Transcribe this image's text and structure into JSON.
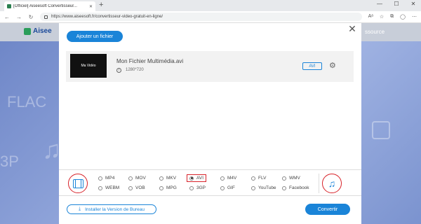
{
  "browser": {
    "tab_title": "[Officiel] Aiseesoft Convertisseur...",
    "tab_close": "✕",
    "new_tab": "+",
    "url": "https://www.aiseesoft.fr/convertisseur-video-gratuit-en-ligne/",
    "nav_back": "←",
    "nav_forward": "→",
    "nav_reload": "↻",
    "win_min": "—",
    "win_max": "☐",
    "win_close": "✕"
  },
  "page": {
    "logo_text": "Aisee",
    "ressource": "ssource",
    "deco_flac": "FLAC",
    "deco_3p": "3P",
    "deco_note": "♫"
  },
  "modal": {
    "close": "✕",
    "add_file_label": "Ajouter un fichier",
    "file": {
      "thumb_text": "Ma Vidéo",
      "name": "Mon Fichier Multimédia.avi",
      "info_icon": "i",
      "resolution": "1280*720",
      "format_badge": "AVI",
      "gear": "⚙"
    },
    "formats_video": [
      {
        "label": "MP4",
        "selected": false
      },
      {
        "label": "MOV",
        "selected": false
      },
      {
        "label": "MKV",
        "selected": false
      },
      {
        "label": "AVI",
        "selected": true
      },
      {
        "label": "M4V",
        "selected": false
      },
      {
        "label": "FLV",
        "selected": false
      },
      {
        "label": "WMV",
        "selected": false
      },
      {
        "label": "WEBM",
        "selected": false
      },
      {
        "label": "VOB",
        "selected": false
      },
      {
        "label": "MPG",
        "selected": false
      },
      {
        "label": "3GP",
        "selected": false
      },
      {
        "label": "GIF",
        "selected": false
      },
      {
        "label": "YouTube",
        "selected": false
      },
      {
        "label": "Facebook",
        "selected": false
      }
    ],
    "audio_icon": "♫",
    "install_label": "Installer la Version de Bureau",
    "install_icon": "⤓",
    "convert_label": "Convertir"
  },
  "colors": {
    "accent": "#1a84d8",
    "highlight": "#d8232a"
  }
}
